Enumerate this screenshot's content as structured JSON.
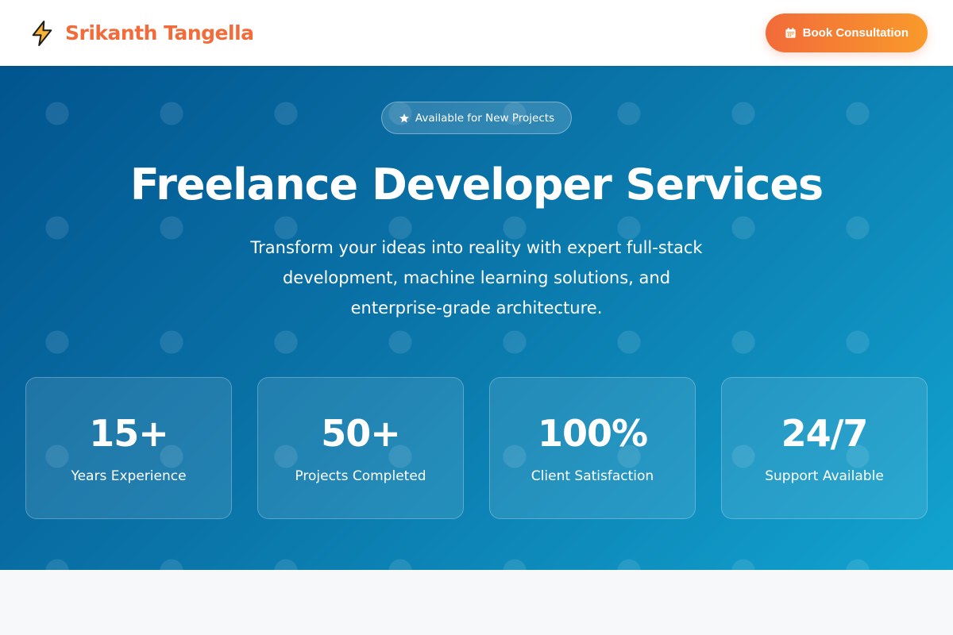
{
  "header": {
    "brand_name": "Srikanth Tangella",
    "brand_icon": "lightning-bolt-icon",
    "cta_label": "Book Consultation",
    "cta_icon": "calendar-icon"
  },
  "hero": {
    "badge_label": "Available for New Projects",
    "badge_icon": "star-icon",
    "title": "Freelance Developer Services",
    "subtitle": "Transform your ideas into reality with expert full-stack development, machine learning solutions, and enterprise-grade architecture.",
    "stats": [
      {
        "value": "15+",
        "label": "Years Experience"
      },
      {
        "value": "50+",
        "label": "Projects Completed"
      },
      {
        "value": "100%",
        "label": "Client Satisfaction"
      },
      {
        "value": "24/7",
        "label": "Support Available"
      }
    ]
  },
  "colors": {
    "brand_orange": "#f26b3a",
    "cta_gradient_end": "#f99a2b",
    "hero_gradient_start": "#02558f",
    "hero_gradient_end": "#12a3cf"
  }
}
